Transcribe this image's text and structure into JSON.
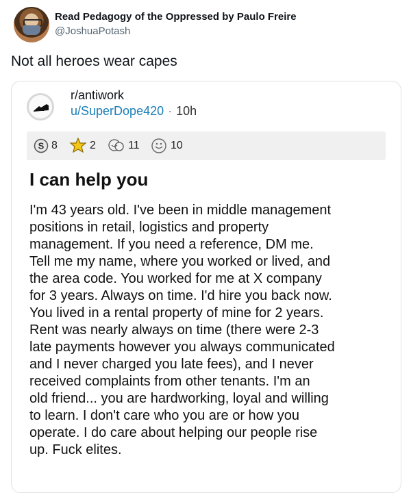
{
  "tweet": {
    "display_name": "Read Pedagogy of the Oppressed by Paulo Freire",
    "handle": "@JoshuaPotash",
    "text": "Not all heroes wear capes"
  },
  "reddit_card": {
    "subreddit": "r/antiwork",
    "username": "u/SuperDope420",
    "separator": "·",
    "time": "10h",
    "awards": [
      {
        "icon": "silver-award-icon",
        "count": "8"
      },
      {
        "icon": "gold-award-icon",
        "count": "2"
      },
      {
        "icon": "wholesome-award-icon",
        "count": "11"
      },
      {
        "icon": "helpful-award-icon",
        "count": "10"
      }
    ],
    "title": "I can help you",
    "body_lines": [
      "I'm 43 years old. I've been in middle management",
      "positions in retail, logistics and property",
      "management. If you need a reference, DM me.",
      "Tell me my name, where you worked or lived, and",
      "the area code. You worked for me at X company",
      "for 3 years. Always on time. I'd hire you back now.",
      "You lived in a rental property of mine for 2 years.",
      "Rent was nearly always on time (there were 2-3",
      "late payments however you always communicated",
      "and I never charged you late fees), and I never",
      "received complaints from other tenants. I'm an",
      "old friend... you are hardworking, loyal and willing",
      "to learn. I don't care who you are or how you",
      "operate. I do care about helping our people rise",
      "up. Fuck elites."
    ]
  }
}
